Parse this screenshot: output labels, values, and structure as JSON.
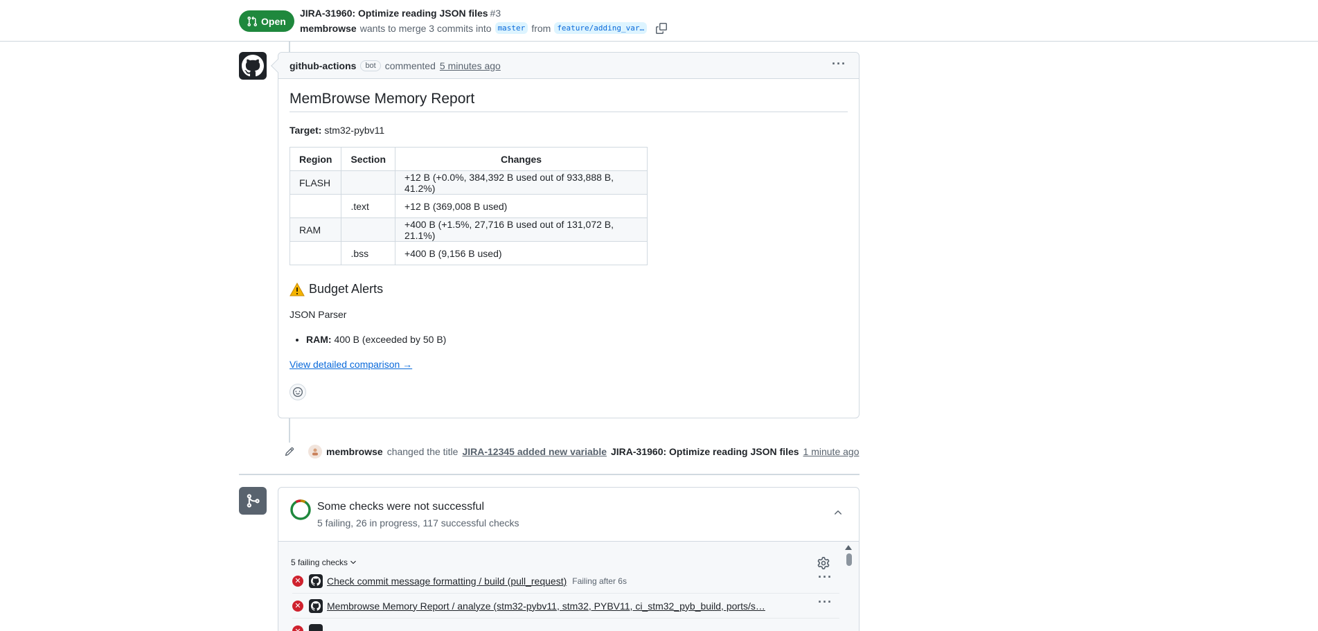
{
  "header": {
    "state": "Open",
    "title": "JIRA-31960: Optimize reading JSON files",
    "number": "#3",
    "author": "membrowse",
    "merge_text": "wants to merge 3 commits into",
    "base_branch": "master",
    "from_text": "from",
    "head_branch": "feature/adding_var…"
  },
  "comment": {
    "author": "github-actions",
    "bot_label": "bot",
    "action": "commented",
    "time": "5 minutes ago",
    "report_title": "MemBrowse Memory Report",
    "target_label": "Target:",
    "target_value": "stm32-pybv11",
    "table": {
      "headers": [
        "Region",
        "Section",
        "Changes"
      ],
      "rows": [
        [
          "FLASH",
          "",
          "+12 B (+0.0%, 384,392 B used out of 933,888 B, 41.2%)"
        ],
        [
          "",
          ".text",
          "+12 B (369,008 B used)"
        ],
        [
          "RAM",
          "",
          "+400 B (+1.5%, 27,716 B used out of 131,072 B, 21.1%)"
        ],
        [
          "",
          ".bss",
          "+400 B (9,156 B used)"
        ]
      ]
    },
    "budget_title": "Budget Alerts",
    "parser_title": "JSON Parser",
    "alert_label": "RAM:",
    "alert_text": "400 B (exceeded by 50 B)",
    "detail_link": "View detailed comparison →"
  },
  "event": {
    "who": "membrowse",
    "action": "changed the title",
    "old_title": "JIRA-12345 added new variable",
    "new_title": "JIRA-31960: Optimize reading JSON files",
    "time": "1 minute ago"
  },
  "checks": {
    "title": "Some checks were not successful",
    "summary": "5 failing, 26 in progress, 117 successful checks",
    "failing_toggle": "5 failing checks",
    "rows": [
      {
        "name": "Check commit message formatting / build (pull_request)",
        "status": "Failing after 6s"
      },
      {
        "name": "Membrowse Memory Report / analyze (stm32-pybv11, stm32, PYBV11, ci_stm32_pyb_build, ports/s…",
        "status": ""
      }
    ],
    "colors": {
      "fail": "#cf222e",
      "success": "#1f883d",
      "pending": "#bf8700"
    }
  }
}
